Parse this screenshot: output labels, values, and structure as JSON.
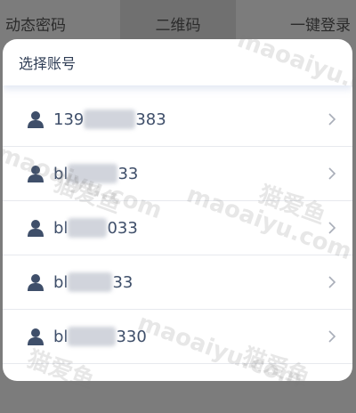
{
  "tabs": [
    {
      "label": "动态密码"
    },
    {
      "label": "二维码"
    },
    {
      "label": "一键登录"
    }
  ],
  "sheet": {
    "title": "选择账号"
  },
  "accounts": [
    {
      "prefix": "139",
      "suffix": "383"
    },
    {
      "prefix": "bl",
      "suffix": "33"
    },
    {
      "prefix": "bl",
      "suffix": "033"
    },
    {
      "prefix": "bl",
      "suffix": "33"
    },
    {
      "prefix": "bl",
      "suffix": "330"
    }
  ],
  "watermarks": [
    {
      "text": "maoaiyu.com"
    },
    {
      "text": "猫爱鱼"
    },
    {
      "text": "maoaiyu.com"
    },
    {
      "text": "猫爱鱼"
    },
    {
      "text": "maoaiyu.com"
    },
    {
      "text": "猫爱鱼"
    },
    {
      "text": "maoaiyu.com"
    },
    {
      "text": "猫爱鱼"
    }
  ],
  "colors": {
    "overlay": "#7c7c7c",
    "text": "#3f4f6a",
    "icon": "#3f4f6a"
  }
}
